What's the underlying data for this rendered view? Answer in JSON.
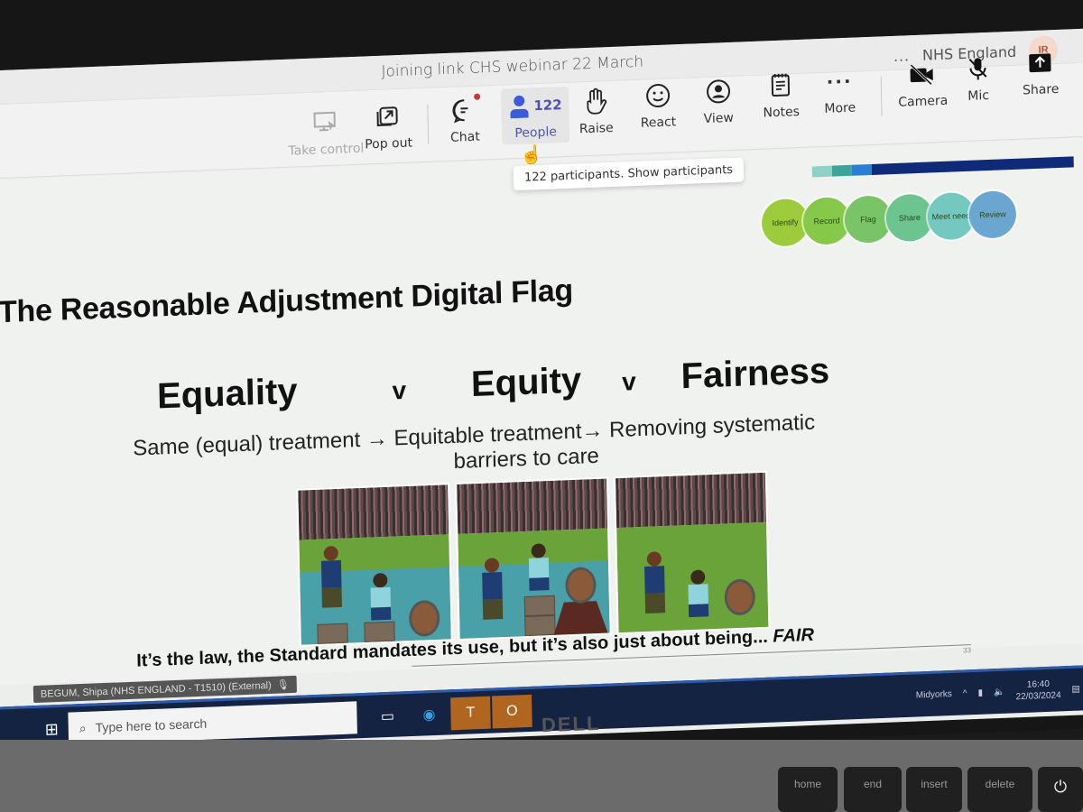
{
  "meeting": {
    "title": "Joining link CHS webinar 22 March",
    "org_name": "NHS England",
    "avatar_initials": "IR",
    "more_options": "..."
  },
  "toolbar": {
    "take_control": "Take control",
    "pop_out": "Pop out",
    "chat": "Chat",
    "people": "People",
    "people_count": "122",
    "raise": "Raise",
    "react": "React",
    "view": "View",
    "notes": "Notes",
    "more": "More",
    "camera": "Camera",
    "mic": "Mic",
    "share": "Share"
  },
  "tooltip": "122 participants. Show participants",
  "slide": {
    "title": "The Reasonable Adjustment Digital Flag",
    "flow_steps": [
      {
        "label": "Identify",
        "color": "#9ccc3c"
      },
      {
        "label": "Record",
        "color": "#86c84a"
      },
      {
        "label": "Flag",
        "color": "#78c466"
      },
      {
        "label": "Share",
        "color": "#6cc48e"
      },
      {
        "label": "Meet need",
        "color": "#74c8c0"
      },
      {
        "label": "Review",
        "color": "#6aa6d0"
      }
    ],
    "progress_segments": [
      {
        "color": "#8fd1c6"
      },
      {
        "color": "#3aa69a"
      },
      {
        "color": "#2a7fd4"
      },
      {
        "color": "#0e2a78"
      }
    ],
    "headings": {
      "equality": "Equality",
      "v1": "v",
      "equity": "Equity",
      "v2": "v",
      "fairness": "Fairness"
    },
    "subtitle_line1": "Same (equal) treatment → Equitable treatment→ Removing systematic",
    "subtitle_line2": "barriers to care",
    "panels": [
      {
        "label": "Equality illustration"
      },
      {
        "label": "Equity illustration"
      },
      {
        "label": "Fairness illustration"
      }
    ],
    "footer_text": "It’s the law, the Standard mandates its use, but it’s also just about being... ",
    "footer_emphasis": "FAIR",
    "slide_number": "33"
  },
  "presenter_tag": "BEGUM, Shipa (NHS ENGLAND - T1510) (External)",
  "taskbar": {
    "search_placeholder": "Type here to search",
    "network_label": "Midyorks",
    "time": "16:40",
    "date": "22/03/2024"
  },
  "hardware": {
    "brand": "DELL",
    "keys": [
      "home",
      "end",
      "insert",
      "delete"
    ]
  }
}
